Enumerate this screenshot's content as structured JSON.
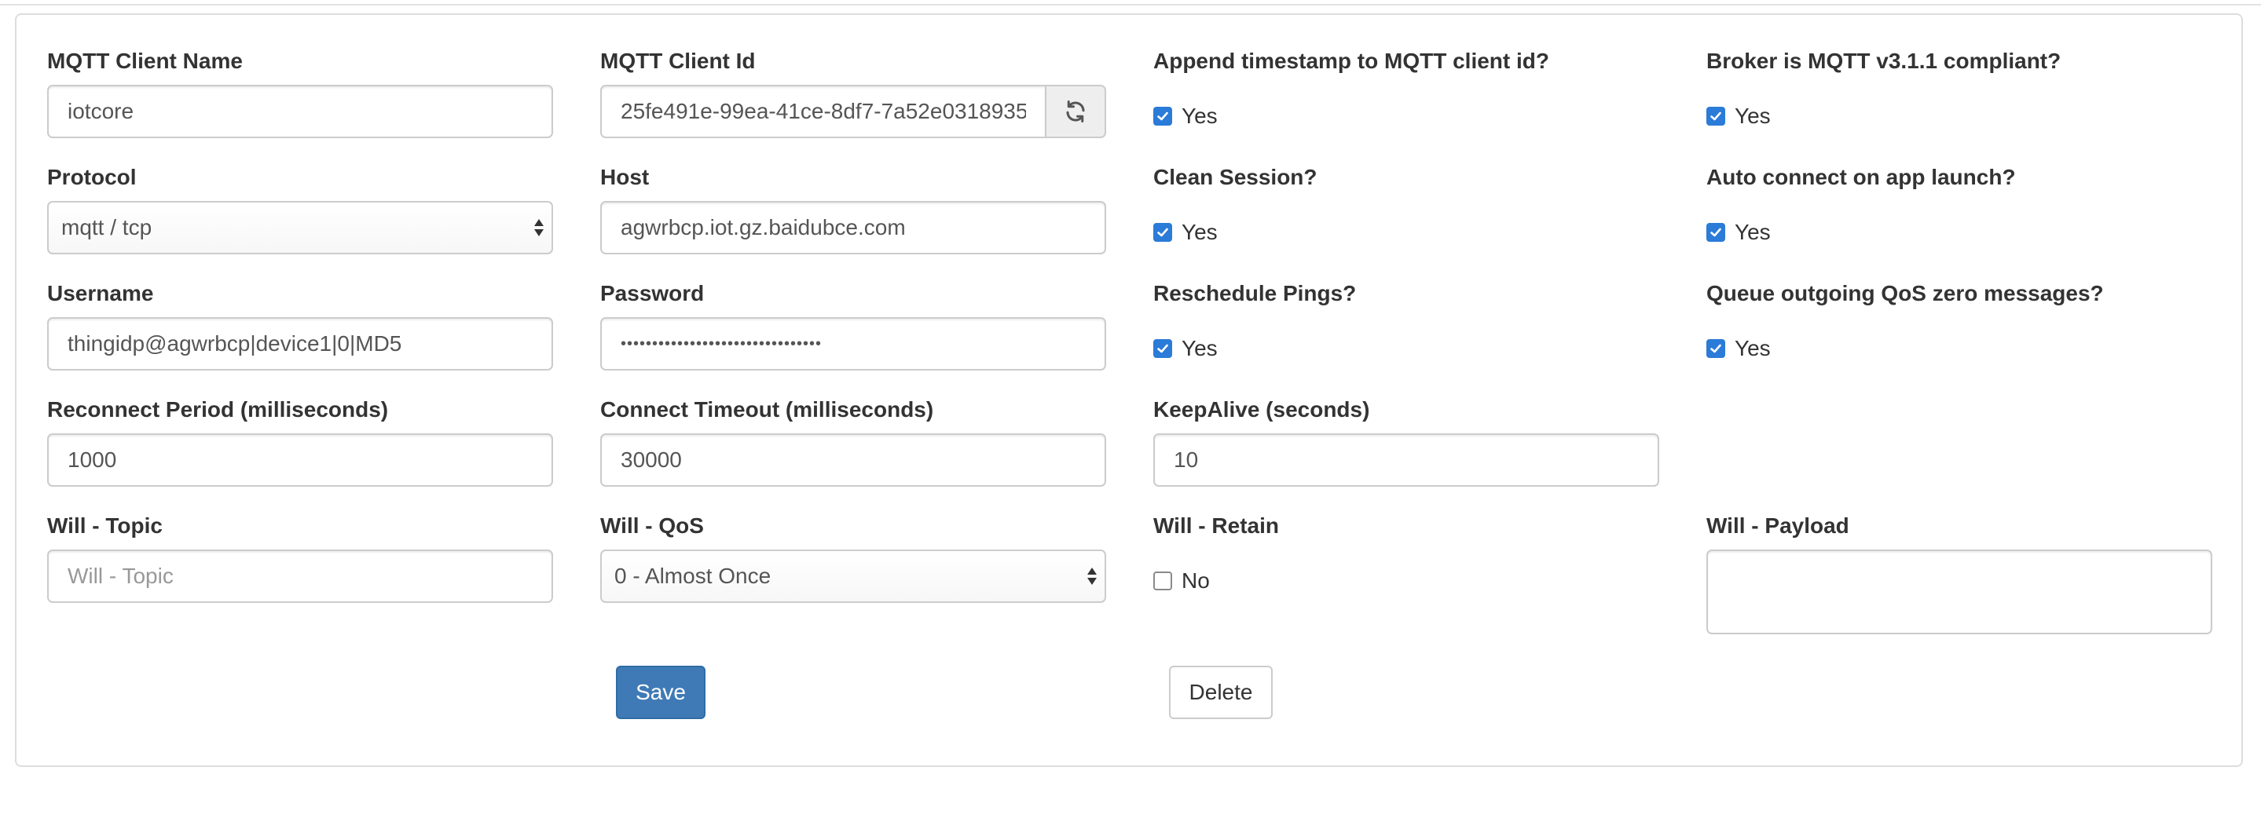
{
  "form": {
    "client_name": {
      "label": "MQTT Client Name",
      "value": "iotcore"
    },
    "client_id": {
      "label": "MQTT Client Id",
      "value": "25fe491e-99ea-41ce-8df7-7a52e0318935",
      "refresh_icon": "refresh-icon"
    },
    "append_timestamp": {
      "label": "Append timestamp to MQTT client id?",
      "checked": true,
      "text": "Yes"
    },
    "broker_compliant": {
      "label": "Broker is MQTT v3.1.1 compliant?",
      "checked": true,
      "text": "Yes"
    },
    "protocol": {
      "label": "Protocol",
      "selected": "mqtt / tcp"
    },
    "host": {
      "label": "Host",
      "value": "agwrbcp.iot.gz.baidubce.com"
    },
    "clean_session": {
      "label": "Clean Session?",
      "checked": true,
      "text": "Yes"
    },
    "auto_connect": {
      "label": "Auto connect on app launch?",
      "checked": true,
      "text": "Yes"
    },
    "username": {
      "label": "Username",
      "value": "thingidp@agwrbcp|device1|0|MD5"
    },
    "password": {
      "label": "Password",
      "value": "••••••••••••••••••••••••••••••••"
    },
    "reschedule_pings": {
      "label": "Reschedule Pings?",
      "checked": true,
      "text": "Yes"
    },
    "queue_qos_zero": {
      "label": "Queue outgoing QoS zero messages?",
      "checked": true,
      "text": "Yes"
    },
    "reconnect_period": {
      "label": "Reconnect Period (milliseconds)",
      "value": "1000"
    },
    "connect_timeout": {
      "label": "Connect Timeout (milliseconds)",
      "value": "30000"
    },
    "keepalive": {
      "label": "KeepAlive (seconds)",
      "value": "10"
    },
    "will_topic": {
      "label": "Will - Topic",
      "placeholder": "Will - Topic",
      "value": ""
    },
    "will_qos": {
      "label": "Will - QoS",
      "selected": "0 - Almost Once"
    },
    "will_retain": {
      "label": "Will - Retain",
      "checked": false,
      "text": "No"
    },
    "will_payload": {
      "label": "Will - Payload",
      "value": ""
    }
  },
  "actions": {
    "save_label": "Save",
    "delete_label": "Delete"
  },
  "colors": {
    "primary": "#3f7ab6",
    "checkbox": "#2b7bd8",
    "border": "#cccccc"
  }
}
